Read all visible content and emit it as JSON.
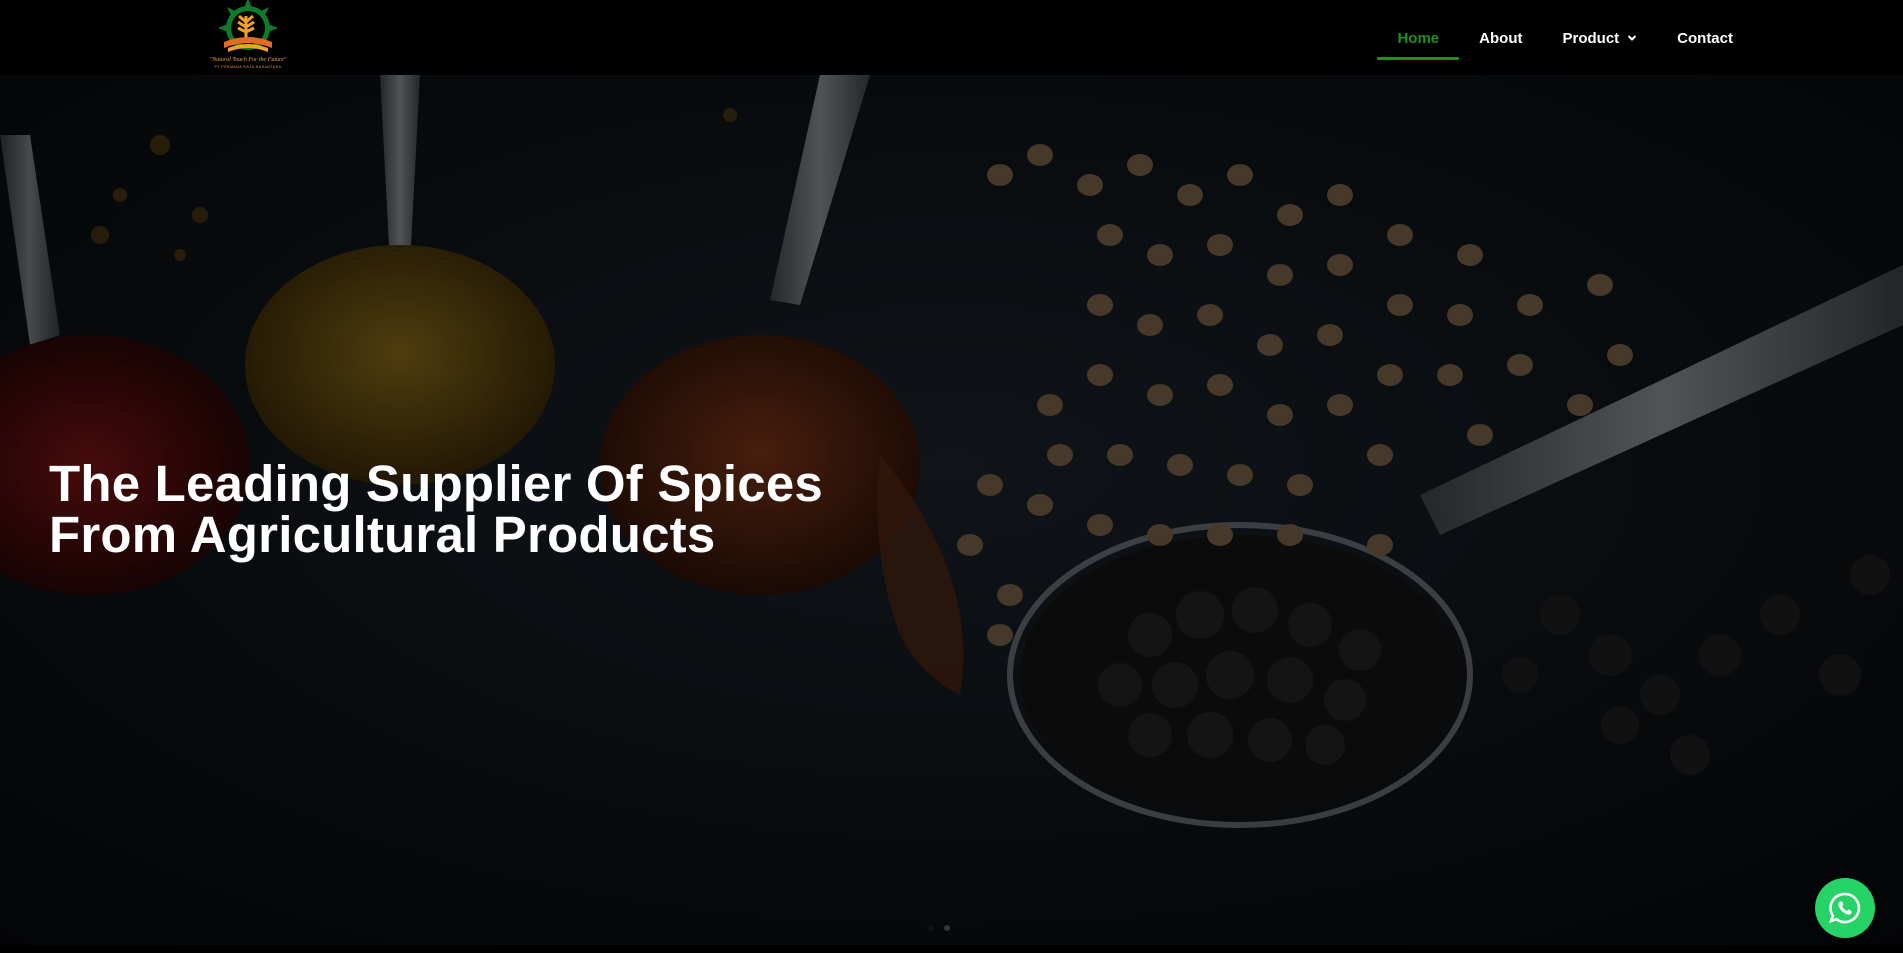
{
  "logo": {
    "tagline": "\"Natural Touch For the Future\"",
    "company": "PT PERMANA RAJA NUSANTARA"
  },
  "nav": {
    "items": [
      {
        "label": "Home",
        "active": true
      },
      {
        "label": "About",
        "active": false
      },
      {
        "label": "Product",
        "active": false,
        "has_dropdown": true
      },
      {
        "label": "Contact",
        "active": false
      }
    ]
  },
  "hero": {
    "title_line1": "The Leading Supplier Of Spices",
    "title_line2": "From Agricultural Products",
    "slides": 2,
    "active_slide": 1
  },
  "colors": {
    "accent": "#1f8f1f",
    "whatsapp": "#25d366",
    "header_bg": "#000000"
  },
  "icons": {
    "whatsapp": "whatsapp-icon",
    "dropdown": "chevron-down-icon"
  }
}
